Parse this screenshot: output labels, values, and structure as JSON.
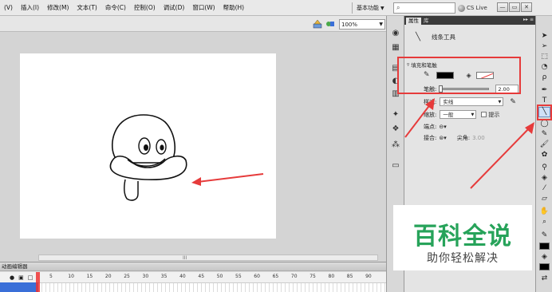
{
  "menubar": {
    "items": [
      "(V)",
      "插入(I)",
      "修改(M)",
      "文本(T)",
      "命令(C)",
      "控制(O)",
      "调试(D)",
      "窗口(W)",
      "帮助(H)"
    ],
    "workspace": "基本功能",
    "search_placeholder": "",
    "cslive": "CS Live"
  },
  "stage": {
    "zoom": "100%",
    "scroll_grip": "III"
  },
  "timeline": {
    "title": "动画编辑器",
    "frame_numbers": [
      "5",
      "10",
      "15",
      "20",
      "25",
      "30",
      "35",
      "40",
      "45",
      "50",
      "55",
      "60",
      "65",
      "70",
      "75",
      "80",
      "85",
      "90"
    ]
  },
  "properties": {
    "tabs": [
      "属性",
      "库"
    ],
    "tool_name": "线条工具",
    "section_fill_stroke": "填充和笔触",
    "stroke_label": "笔触:",
    "stroke_value": "2.00",
    "style_label": "样式:",
    "style_value": "实线",
    "scale_label": "缩放:",
    "scale_value": "一般",
    "hint_label": "提示",
    "cap_label": "端点:",
    "join_label": "接合:",
    "miter_label": "尖角:",
    "miter_value": "3.00",
    "fill_color": "#000000",
    "highlight_color": "#e63b3b"
  },
  "watermark": {
    "title": "百科全说",
    "subtitle": "助你轻松解决"
  }
}
